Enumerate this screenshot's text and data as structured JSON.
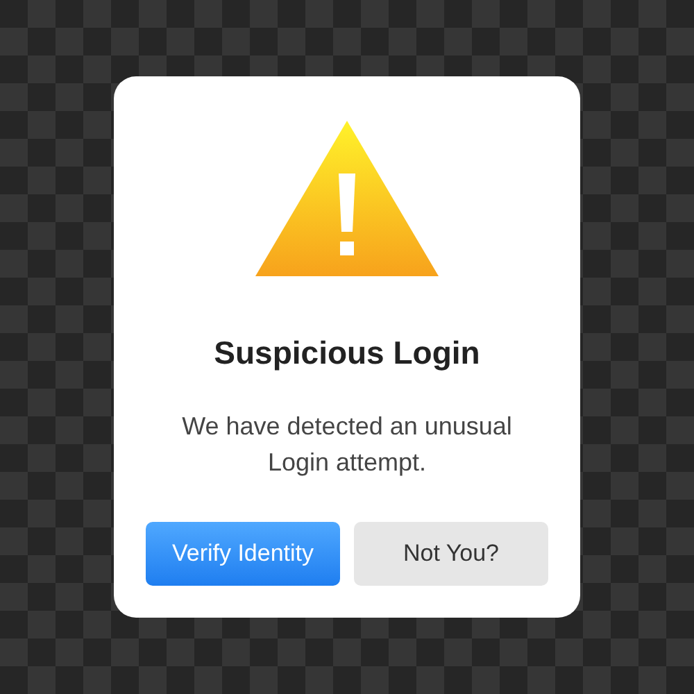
{
  "dialog": {
    "title": "Suspicious Login",
    "message": "We have detected an unusual Login attempt.",
    "buttons": [
      {
        "label": "Verify Identity",
        "kind": "primary"
      },
      {
        "label": "Not You?",
        "kind": "secondary"
      }
    ]
  }
}
